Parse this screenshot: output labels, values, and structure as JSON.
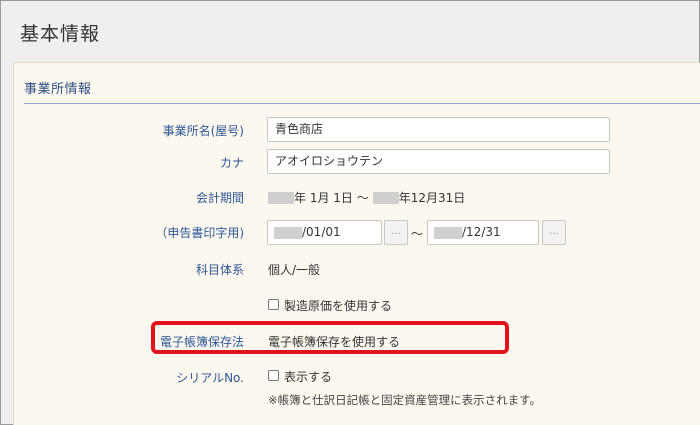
{
  "page": {
    "title": "基本情報"
  },
  "section": {
    "title": "事業所情報"
  },
  "fields": {
    "business_name": {
      "label": "事業所名(屋号)",
      "value": "青色商店"
    },
    "kana": {
      "label": "カナ",
      "value": "アオイロショウテン"
    },
    "fiscal_period": {
      "label": "会計期間",
      "start_suffix": "年 1月 1日 ～",
      "end_suffix": "年12月31日"
    },
    "filing_period": {
      "label": "（申告書印字用)",
      "start_value": "/01/01",
      "separator": "～",
      "end_value": "/12/31",
      "picker_label": "..."
    },
    "account_system": {
      "label": "科目体系",
      "value": "個人/一般"
    },
    "manufacturing_cost": {
      "label": "製造原価を使用する",
      "checked": false
    },
    "e_ledger": {
      "label": "電子帳簿保存法",
      "value": "電子帳簿保存を使用する"
    },
    "serial_no": {
      "label": "シリアルNo.",
      "checkbox_label": "表示する",
      "checked": false,
      "note": "※帳簿と仕訳日記帳と固定資産管理に表示されます。"
    }
  },
  "colors": {
    "label_blue": "#2d5698",
    "panel_bg": "#fdf8ef",
    "highlight_red": "#e0121c"
  }
}
